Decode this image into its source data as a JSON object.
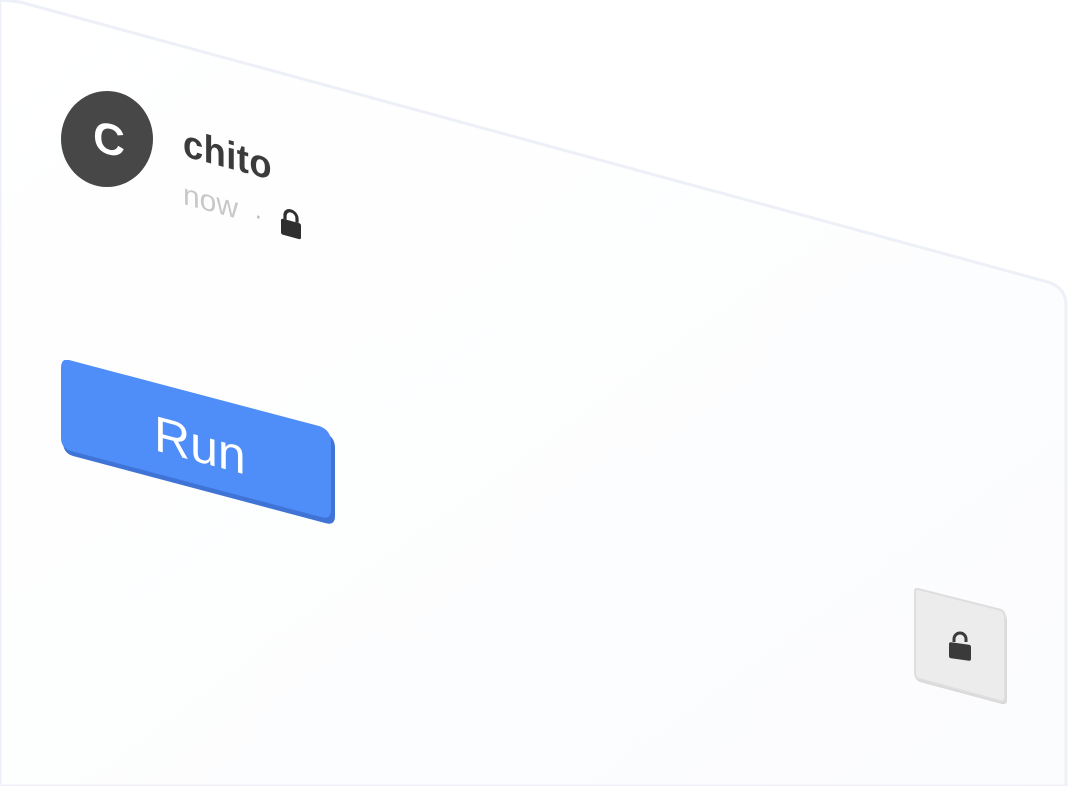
{
  "post": {
    "avatar_letter": "C",
    "user_name": "chito",
    "timestamp": "now",
    "separator": "·",
    "visibility_icon": "lock-icon"
  },
  "actions": {
    "run_label": "Run",
    "lock_button_icon": "lock-icon"
  },
  "colors": {
    "avatar_bg": "#474747",
    "run_button": "#4f8df8",
    "run_button_edge": "#3f74d6",
    "lock_button_bg": "#ececec",
    "card_border": "#eef0f7"
  }
}
